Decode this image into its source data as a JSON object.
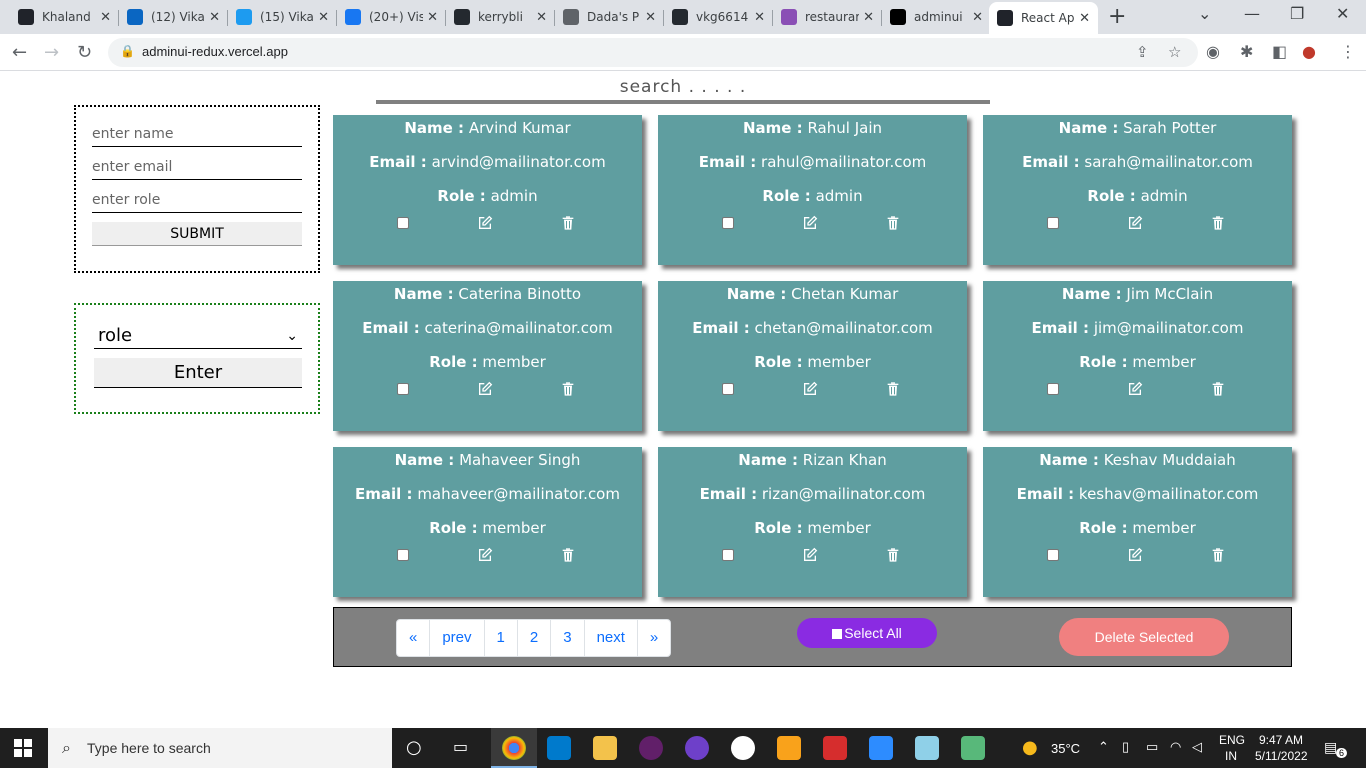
{
  "browser": {
    "tabs": [
      {
        "title": "Khaland",
        "color": "#20232a"
      },
      {
        "title": "(12) Vika",
        "color": "#0a66c2"
      },
      {
        "title": "(15) Vika",
        "color": "#1d9bf0"
      },
      {
        "title": "(20+) Vis",
        "color": "#1877f2"
      },
      {
        "title": "kerrybli",
        "color": "#24292f"
      },
      {
        "title": "Dada's P",
        "color": "#5f6368"
      },
      {
        "title": "vkg6614",
        "color": "#24292f"
      },
      {
        "title": "restaurar",
        "color": "#8a4fb5"
      },
      {
        "title": "adminui",
        "color": "#000000"
      },
      {
        "title": "React Ap",
        "color": "#20232a"
      }
    ],
    "url": "adminui-redux.vercel.app"
  },
  "page": {
    "search_placeholder": "search . . . . .",
    "form": {
      "name_placeholder": "enter name",
      "email_placeholder": "enter email",
      "role_placeholder": "enter role",
      "submit_label": "SUBMIT"
    },
    "role_filter": {
      "selected": "role",
      "enter_label": "Enter"
    },
    "field_labels": {
      "name": "Name :",
      "email": "Email :",
      "role": "Role :"
    },
    "users": [
      {
        "name": "Arvind Kumar",
        "email": "arvind@mailinator.com",
        "role": "admin"
      },
      {
        "name": "Rahul Jain",
        "email": "rahul@mailinator.com",
        "role": "admin"
      },
      {
        "name": "Sarah Potter",
        "email": "sarah@mailinator.com",
        "role": "admin"
      },
      {
        "name": "Caterina Binotto",
        "email": "caterina@mailinator.com",
        "role": "member"
      },
      {
        "name": "Chetan Kumar",
        "email": "chetan@mailinator.com",
        "role": "member"
      },
      {
        "name": "Jim McClain",
        "email": "jim@mailinator.com",
        "role": "member"
      },
      {
        "name": "Mahaveer Singh",
        "email": "mahaveer@mailinator.com",
        "role": "member"
      },
      {
        "name": "Rizan Khan",
        "email": "rizan@mailinator.com",
        "role": "member"
      },
      {
        "name": "Keshav Muddaiah",
        "email": "keshav@mailinator.com",
        "role": "member"
      }
    ],
    "pagination": {
      "first": "«",
      "prev": "prev",
      "pages": [
        "1",
        "2",
        "3"
      ],
      "next": "next",
      "last": "»"
    },
    "select_all_label": "Select All",
    "delete_selected_label": "Delete Selected",
    "colors": {
      "card": "#5f9ea0",
      "select_all": "#8a2be2",
      "delete": "#f08080"
    }
  },
  "taskbar": {
    "search_placeholder": "Type here to search",
    "weather": "35°C",
    "lang_top": "ENG",
    "lang_bottom": "IN",
    "time": "9:47 AM",
    "date": "5/11/2022",
    "notifications": "6"
  }
}
